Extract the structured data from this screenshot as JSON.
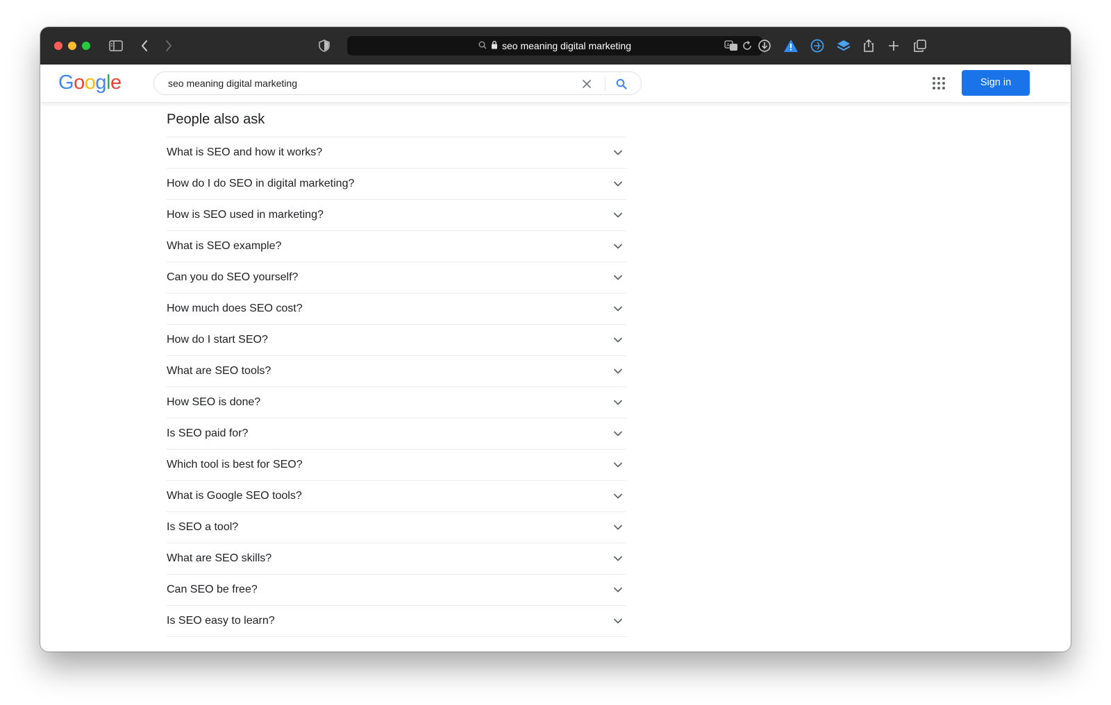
{
  "browser": {
    "url_text": "seo meaning digital marketing"
  },
  "colors": {
    "traffic_red": "#ff5f57",
    "traffic_yellow": "#febc2e",
    "traffic_green": "#28c840",
    "google_blue": "#4285f4",
    "google_red": "#ea4335",
    "google_yellow": "#fbbc05",
    "google_green": "#34a853",
    "signin_blue": "#1a73e8"
  },
  "google": {
    "logo": "Google",
    "search_value": "seo meaning digital marketing",
    "sign_in_label": "Sign in"
  },
  "icons": [
    "sidebar-icon",
    "back-icon",
    "forward-icon",
    "shield-icon",
    "search-icon",
    "lock-icon",
    "translate-icon",
    "reload-icon",
    "download-icon",
    "warning-icon",
    "extension-icon",
    "layers-icon",
    "share-icon",
    "new-tab-icon",
    "tabs-overview-icon",
    "clear-icon",
    "google-search-icon",
    "apps-grid-icon",
    "chevron-down-icon"
  ],
  "paa": {
    "title": "People also ask",
    "questions": [
      "What is SEO and how it works?",
      "How do I do SEO in digital marketing?",
      "How is SEO used in marketing?",
      "What is SEO example?",
      "Can you do SEO yourself?",
      "How much does SEO cost?",
      "How do I start SEO?",
      "What are SEO tools?",
      "How SEO is done?",
      "Is SEO paid for?",
      "Which tool is best for SEO?",
      "What is Google SEO tools?",
      "Is SEO a tool?",
      "What are SEO skills?",
      "Can SEO be free?",
      "Is SEO easy to learn?"
    ]
  }
}
